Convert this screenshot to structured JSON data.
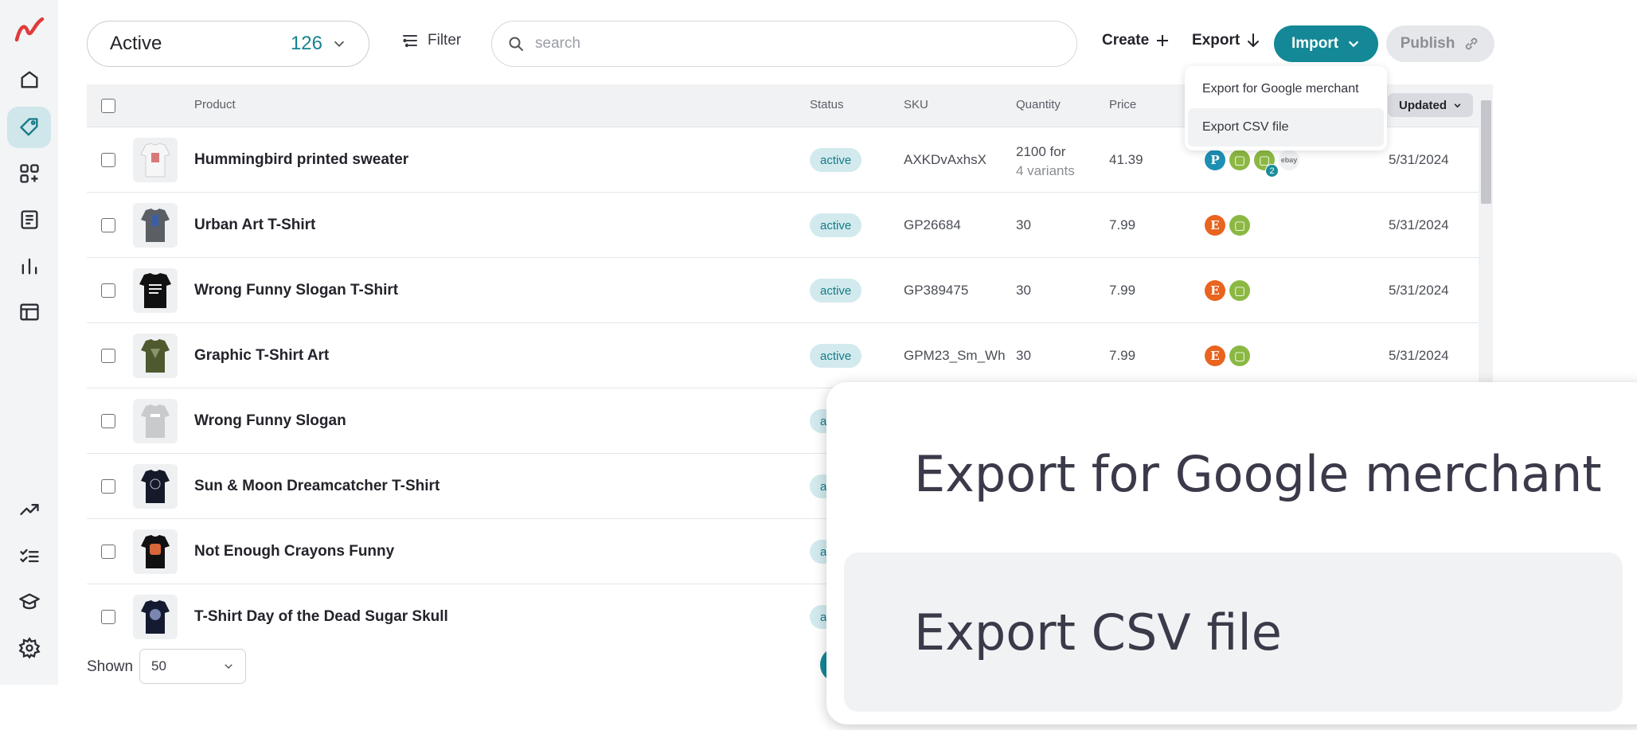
{
  "sidebar": {
    "items": [
      {
        "icon": "home-icon"
      },
      {
        "icon": "tag-icon",
        "active": true
      },
      {
        "icon": "apps-add-icon"
      },
      {
        "icon": "document-icon"
      },
      {
        "icon": "bar-chart-icon"
      },
      {
        "icon": "layout-icon"
      }
    ],
    "bottom_items": [
      {
        "icon": "trending-up-icon"
      },
      {
        "icon": "checklist-icon"
      },
      {
        "icon": "graduation-cap-icon"
      },
      {
        "icon": "settings-icon"
      }
    ]
  },
  "toolbar": {
    "status_label": "Active",
    "status_count": "126",
    "filter_label": "Filter",
    "search_placeholder": "search",
    "create_label": "Create",
    "export_label": "Export",
    "import_label": "Import",
    "publish_label": "Publish"
  },
  "table": {
    "headers": {
      "product": "Product",
      "status": "Status",
      "sku": "SKU",
      "quantity": "Quantity",
      "price": "Price",
      "updated": "Updated"
    },
    "rows": [
      {
        "name": "Hummingbird printed sweater",
        "status": "active",
        "sku": "AXKDvAxhsX",
        "quantity": "2100 for",
        "quantity_sub": "4 variants",
        "price": "41.39",
        "channels": [
          "pp",
          "shop",
          "shop",
          "ebay"
        ],
        "channel_badge": "2",
        "updated": "5/31/2024"
      },
      {
        "name": "Urban Art T-Shirt",
        "status": "active",
        "sku": "GP26684",
        "quantity": "30",
        "price": "7.99",
        "channels": [
          "etsy",
          "shop"
        ],
        "updated": "5/31/2024"
      },
      {
        "name": "Wrong Funny Slogan T-Shirt",
        "status": "active",
        "sku": "GP389475",
        "quantity": "30",
        "price": "7.99",
        "channels": [
          "etsy",
          "shop"
        ],
        "updated": "5/31/2024"
      },
      {
        "name": "Graphic T-Shirt Art",
        "status": "active",
        "sku": "GPM23_Sm_Wh",
        "quantity": "30",
        "price": "7.99",
        "channels": [
          "etsy",
          "shop"
        ],
        "updated": "5/31/2024"
      },
      {
        "name": "Wrong Funny Slogan",
        "status": "a"
      },
      {
        "name": "Sun & Moon Dreamcatcher T-Shirt",
        "status": "a"
      },
      {
        "name": "Not Enough Crayons Funny",
        "status": "a"
      },
      {
        "name": "T-Shirt Day of the Dead Sugar Skull",
        "status": "a"
      }
    ],
    "channel_glyphs": {
      "etsy": "E",
      "pp": "P",
      "ebay": "ebay"
    }
  },
  "footer": {
    "shown_label": "Shown",
    "shown_value": "50"
  },
  "export_menu": {
    "items": [
      "Export for Google merchant",
      "Export CSV file"
    ]
  },
  "zoom_panel": {
    "items": [
      "Export for Google merchant",
      "Export CSV file"
    ]
  },
  "colors": {
    "accent": "#148896",
    "badge_bg": "#d2eaee",
    "etsy": "#e8641f",
    "shopify": "#8bb843",
    "logo": "#e03a3a"
  }
}
